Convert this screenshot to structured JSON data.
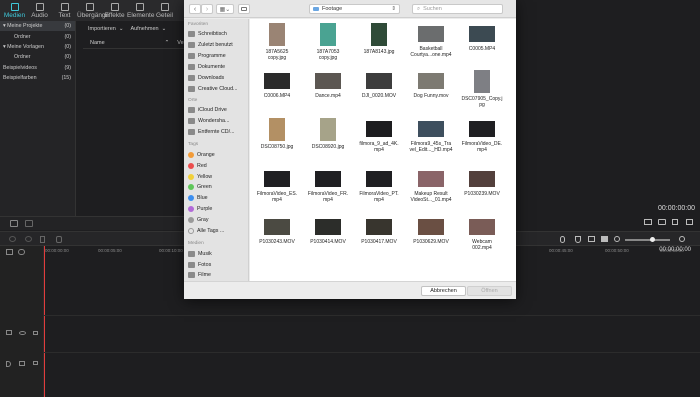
{
  "editor": {
    "tabs": [
      {
        "label": "Medien"
      },
      {
        "label": "Audio"
      },
      {
        "label": "Text"
      },
      {
        "label": "Übergänge"
      },
      {
        "label": "Effekte"
      },
      {
        "label": "Elemente"
      },
      {
        "label": "Geteil"
      }
    ],
    "library": [
      {
        "label": "Meine Projekte",
        "count": "(0)"
      },
      {
        "label": "Ordner",
        "count": "(0)"
      },
      {
        "label": "Meine Vorlagen",
        "count": "(0)"
      },
      {
        "label": "Ordner",
        "count": "(0)"
      },
      {
        "label": "Beispielvideos",
        "count": "(9)"
      },
      {
        "label": "Beispielfarben",
        "count": "(15)"
      }
    ],
    "media_toolbar": {
      "import": "Importieren",
      "record": "Aufnehmen"
    },
    "media_header": {
      "name": "Name",
      "extra": "Verw"
    },
    "preview_time": "00:00:00:00",
    "timeline_time": "00:00:00:00",
    "ruler_ticks": [
      "00:00:00:00",
      "00:00:05:00",
      "00:00:10:00",
      "00:00:45:00",
      "00:00:50:00",
      "00:00:55:00"
    ]
  },
  "dialog": {
    "location": "Footage",
    "search_placeholder": "Suchen",
    "sidebar": {
      "favorites_header": "Favoriten",
      "favorites": [
        "Schreibtisch",
        "Zuletzt benutzt",
        "Programme",
        "Dokumente",
        "Downloads",
        "Creative Cloud..."
      ],
      "locations_header": "Orte",
      "locations": [
        "iCloud Drive",
        "Wondersha...",
        "Entfernte CD/..."
      ],
      "tags_header": "Tags",
      "tags": [
        {
          "label": "Orange",
          "color": "#f29b38"
        },
        {
          "label": "Red",
          "color": "#ec4e4e"
        },
        {
          "label": "Yellow",
          "color": "#f1d03a"
        },
        {
          "label": "Green",
          "color": "#5fc65a"
        },
        {
          "label": "Blue",
          "color": "#3d8ff0"
        },
        {
          "label": "Purple",
          "color": "#b26ad8"
        },
        {
          "label": "Gray",
          "color": "#9a9a9a"
        },
        {
          "label": "Alle Tags ...",
          "color": ""
        }
      ],
      "media_header": "Medien",
      "media": [
        "Musik",
        "Fotos",
        "Filme"
      ]
    },
    "files": [
      {
        "name": "187A5625\ncopy.jpg",
        "thumb": "#9a8474",
        "portrait": true
      },
      {
        "name": "187A7053\ncopy.jpg",
        "thumb": "#4aa392",
        "portrait": true
      },
      {
        "name": "187A8143.jpg",
        "thumb": "#2f4b38",
        "portrait": true
      },
      {
        "name": "Basketball\nCourtya...one.mp4",
        "thumb": "#6b6d6e",
        "portrait": false
      },
      {
        "name": "C0005.MP4",
        "thumb": "#3c4a52",
        "portrait": false
      },
      {
        "name": "C0006.MP4",
        "thumb": "#2b2b2b",
        "portrait": false
      },
      {
        "name": "Dance.mp4",
        "thumb": "#5c5752",
        "portrait": false
      },
      {
        "name": "DJI_0020.MOV",
        "thumb": "#3d3d3d",
        "portrait": false
      },
      {
        "name": "Dog Funny.mov",
        "thumb": "#7d7a72",
        "portrait": false
      },
      {
        "name": "DSC07905_Copy.j\npg",
        "thumb": "#7e7f84",
        "portrait": true
      },
      {
        "name": "DSC08750.jpg",
        "thumb": "#b39064",
        "portrait": true
      },
      {
        "name": "DSC08920.jpg",
        "thumb": "#a6a389",
        "portrait": true
      },
      {
        "name": "filmora_9_ad_4K.\nmp4",
        "thumb": "#1d1d1f",
        "portrait": false
      },
      {
        "name": "Filmora9_45s_Tra\nvel_Edit..._HD.mp4",
        "thumb": "#3e4f5e",
        "portrait": false
      },
      {
        "name": "FilmoraVideo_DE.\nmp4",
        "thumb": "#1f1f22",
        "portrait": false
      },
      {
        "name": "FilmoraVideo_ES.\nmp4",
        "thumb": "#1f1f22",
        "portrait": false
      },
      {
        "name": "FilmoraVideo_FR.\nmp4",
        "thumb": "#1f1f22",
        "portrait": false
      },
      {
        "name": "FilmoraVideo_PT.\nmp4",
        "thumb": "#1f1f22",
        "portrait": false
      },
      {
        "name": "Makeup Result\nVideoSt..._01.mp4",
        "thumb": "#8a6468",
        "portrait": false
      },
      {
        "name": "P1030239.MOV",
        "thumb": "#53403c",
        "portrait": false
      },
      {
        "name": "P1030243.MOV",
        "thumb": "#4b4a42",
        "portrait": false
      },
      {
        "name": "P1030414.MOV",
        "thumb": "#2c2d2a",
        "portrait": false
      },
      {
        "name": "P1030417.MOV",
        "thumb": "#38352e",
        "portrait": false
      },
      {
        "name": "P1030629.MOV",
        "thumb": "#6a4f43",
        "portrait": false
      },
      {
        "name": "Webcam\n002.mp4",
        "thumb": "#7a5c57",
        "portrait": false
      }
    ],
    "cancel_label": "Abbrechen",
    "open_label": "Öffnen"
  }
}
